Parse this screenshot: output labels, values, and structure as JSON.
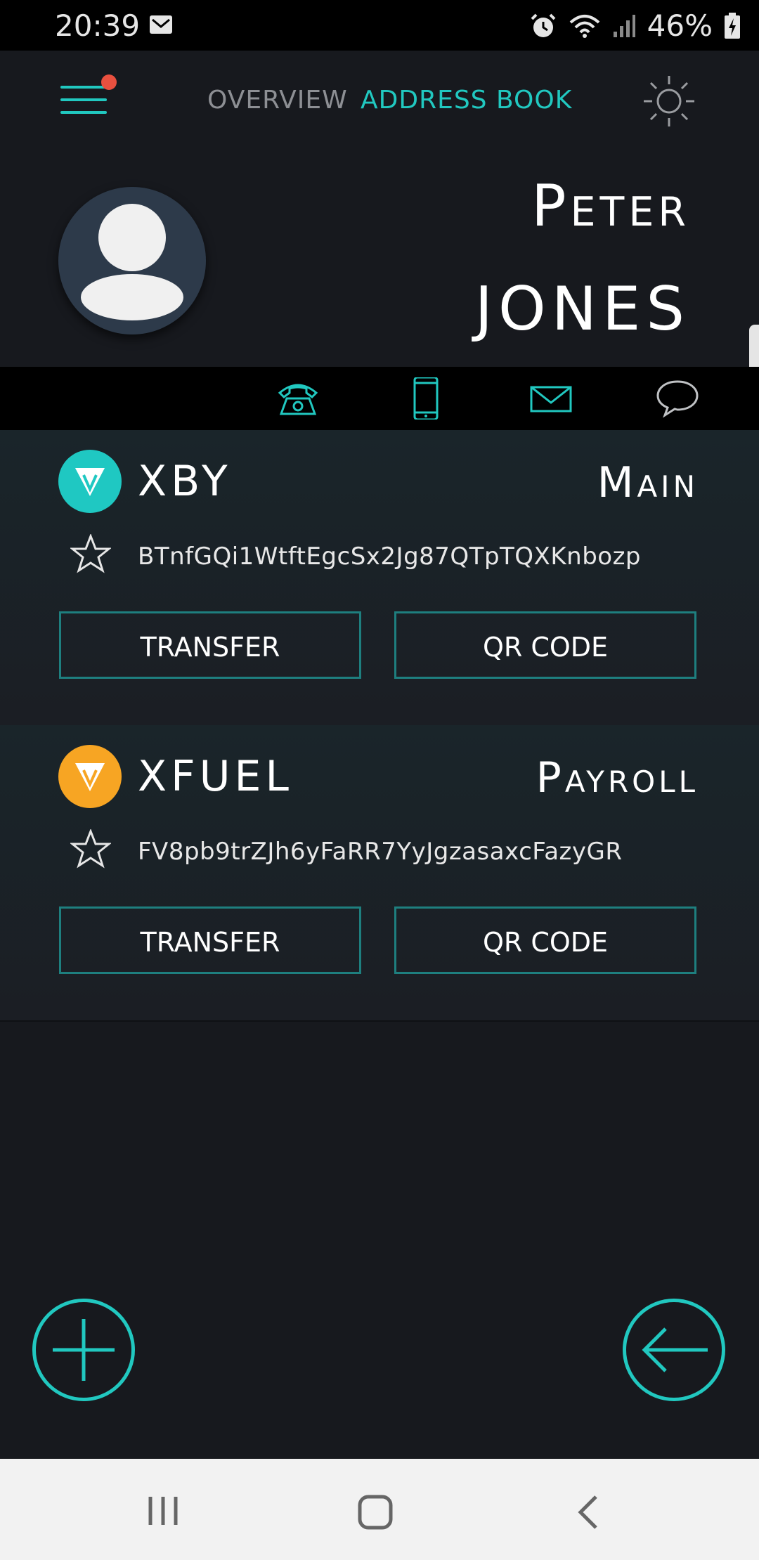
{
  "status_bar": {
    "time": "20:39",
    "battery": "46%",
    "icons": [
      "mail-icon",
      "alarm-icon",
      "wifi-icon",
      "signal-icon",
      "battery-charging-icon"
    ]
  },
  "header": {
    "tabs": [
      {
        "label": "OVERVIEW",
        "active": false
      },
      {
        "label": "ADDRESS BOOK",
        "active": true
      }
    ],
    "menu_icon": "hamburger-menu-icon",
    "settings_icon": "sun-icon",
    "notification_dot_color": "#e9503f"
  },
  "contact": {
    "first_name": "Peter",
    "last_name": "JONES",
    "avatar_icon": "user-avatar-icon",
    "actions": [
      "phone-icon",
      "mobile-phone-icon",
      "mail-icon",
      "chat-bubble-icon"
    ]
  },
  "wallets": [
    {
      "coin": "XBY",
      "label": "Main",
      "address": "BTnfGQi1WtftEgcSx2Jg87QTpTQXKnbozp",
      "logo_color": "#1fc8c2",
      "favorite": false,
      "transfer_label": "TRANSFER",
      "qr_label": "QR CODE"
    },
    {
      "coin": "XFUEL",
      "label": "Payroll",
      "address": "FV8pb9trZJh6yFaRR7YyJgzasaxcFazyGR",
      "logo_color": "#f7a523",
      "favorite": false,
      "transfer_label": "TRANSFER",
      "qr_label": "QR CODE"
    }
  ],
  "fabs": {
    "add_icon": "plus-circle-icon",
    "back_icon": "arrow-left-circle-icon"
  },
  "colors": {
    "accent": "#21c8c0",
    "background": "#17191e",
    "button_border": "#1e7f7f"
  },
  "nav_bar": [
    "recent-apps-icon",
    "home-icon",
    "back-icon"
  ]
}
